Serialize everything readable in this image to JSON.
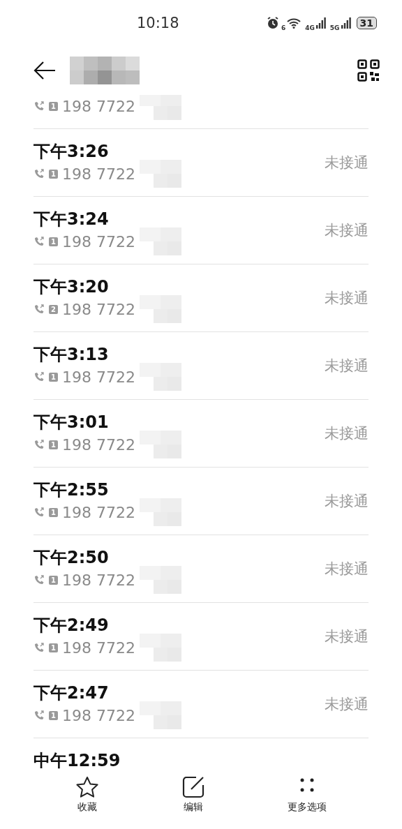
{
  "status_bar": {
    "time": "10:18",
    "wifi_badge": "6",
    "networks": [
      "4G",
      "5G"
    ],
    "battery": "31"
  },
  "calls": [
    {
      "sim": "1",
      "number": "198 7722"
    },
    {
      "time": "下午3:26",
      "sim": "1",
      "number": "198 7722",
      "status": "未接通"
    },
    {
      "time": "下午3:24",
      "sim": "1",
      "number": "198 7722",
      "status": "未接通"
    },
    {
      "time": "下午3:20",
      "sim": "2",
      "number": "198 7722",
      "status": "未接通"
    },
    {
      "time": "下午3:13",
      "sim": "1",
      "number": "198 7722",
      "status": "未接通"
    },
    {
      "time": "下午3:01",
      "sim": "1",
      "number": "198 7722",
      "status": "未接通"
    },
    {
      "time": "下午2:55",
      "sim": "1",
      "number": "198 7722",
      "status": "未接通"
    },
    {
      "time": "下午2:50",
      "sim": "1",
      "number": "198 7722",
      "status": "未接通"
    },
    {
      "time": "下午2:49",
      "sim": "1",
      "number": "198 7722",
      "status": "未接通"
    },
    {
      "time": "下午2:47",
      "sim": "1",
      "number": "198 7722",
      "status": "未接通"
    },
    {
      "time": "中午12:59"
    }
  ],
  "bottom_actions": [
    {
      "kind": "star",
      "label": "收藏"
    },
    {
      "kind": "edit",
      "label": "编辑"
    },
    {
      "kind": "more",
      "label": "更多选项"
    }
  ]
}
